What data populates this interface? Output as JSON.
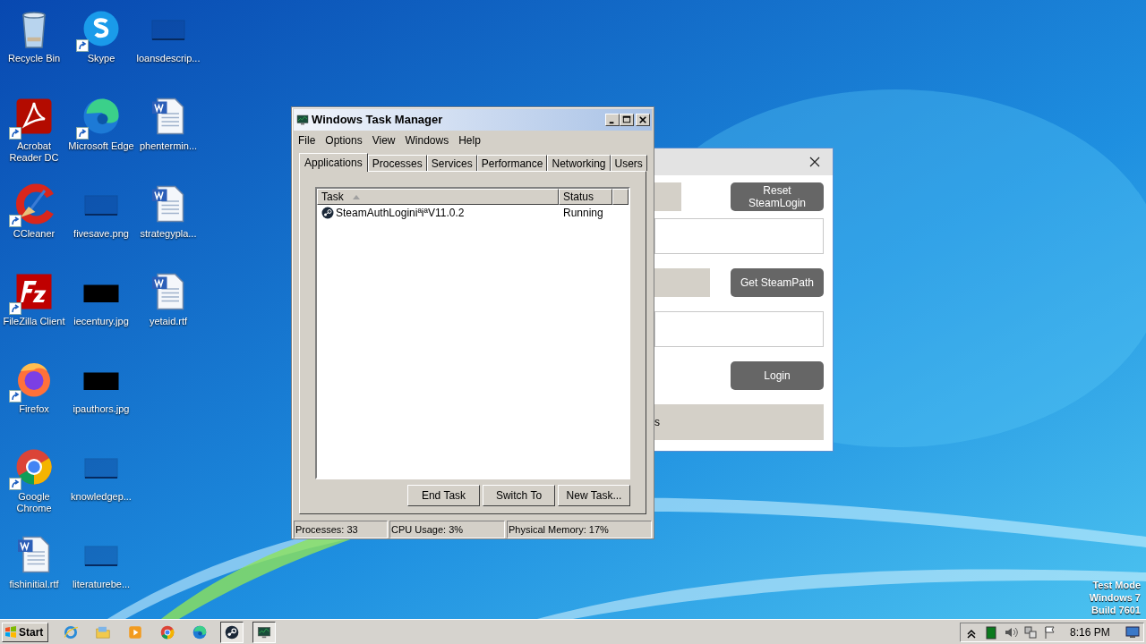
{
  "desktop": {
    "columns": [
      [
        {
          "label": "Recycle Bin",
          "kind": "trash",
          "shortcut": false
        },
        {
          "label": "Acrobat Reader DC",
          "kind": "pdf",
          "shortcut": true
        },
        {
          "label": "CCleaner",
          "kind": "broom",
          "shortcut": true
        },
        {
          "label": "FileZilla Client",
          "kind": "ftp",
          "shortcut": true
        },
        {
          "label": "Firefox",
          "kind": "firefox",
          "shortcut": true
        },
        {
          "label": "Google Chrome",
          "kind": "chrome",
          "shortcut": true
        },
        {
          "label": "fishinitial.rtf",
          "kind": "doc",
          "shortcut": false
        }
      ],
      [
        {
          "label": "Skype",
          "kind": "chat",
          "shortcut": true
        },
        {
          "label": "Microsoft Edge",
          "kind": "edge",
          "shortcut": true
        },
        {
          "label": "fivesave.png",
          "kind": "blank",
          "shortcut": false
        },
        {
          "label": "iecentury.jpg",
          "kind": "dark",
          "shortcut": false
        },
        {
          "label": "ipauthors.jpg",
          "kind": "dark",
          "shortcut": false
        },
        {
          "label": "knowledgep...",
          "kind": "blank",
          "shortcut": false
        },
        {
          "label": "literaturebe...",
          "kind": "blank",
          "shortcut": false
        }
      ],
      [
        {
          "label": "loansdescrip...",
          "kind": "blank",
          "shortcut": false
        },
        {
          "label": "phentermin...",
          "kind": "doc",
          "shortcut": false
        },
        {
          "label": "strategypla...",
          "kind": "doc",
          "shortcut": false
        },
        {
          "label": "yetaid.rtf",
          "kind": "doc",
          "shortcut": false
        }
      ]
    ]
  },
  "app_window": {
    "buttons": [
      "Reset SteamLogin",
      "Get SteamPath",
      "Login"
    ],
    "status_text": "s"
  },
  "task_manager": {
    "title": "Windows Task Manager",
    "menu": [
      "File",
      "Options",
      "View",
      "Windows",
      "Help"
    ],
    "tabs": [
      {
        "label": "Applications",
        "selected": true
      },
      {
        "label": "Processes",
        "selected": false
      },
      {
        "label": "Services",
        "selected": false
      },
      {
        "label": "Performance",
        "selected": false
      },
      {
        "label": "Networking",
        "selected": false
      },
      {
        "label": "Users",
        "selected": false
      }
    ],
    "columns": [
      {
        "label": "Task",
        "sorted": true
      },
      {
        "label": "Status",
        "sorted": false
      }
    ],
    "rows": [
      {
        "task": "SteamAuthLoginiªiªV11.0.2",
        "status": "Running",
        "selected": false
      }
    ],
    "buttons": [
      "End Task",
      "Switch To",
      "New Task..."
    ],
    "status_bar": [
      "Processes: 33",
      "CPU Usage: 3%",
      "Physical Memory: 17%"
    ]
  },
  "os_notice": [
    "Test Mode",
    "Windows 7",
    "Build 7601"
  ],
  "taskbar": {
    "start": "Start",
    "apps": [
      {
        "kind": "ie",
        "active": false
      },
      {
        "kind": "folder",
        "active": false
      },
      {
        "kind": "media",
        "active": false
      },
      {
        "kind": "chrome",
        "active": false
      },
      {
        "kind": "edge",
        "active": false
      },
      {
        "kind": "steam",
        "active": true
      },
      {
        "kind": "monitor",
        "active": true
      }
    ],
    "clock": "8:16 PM"
  }
}
